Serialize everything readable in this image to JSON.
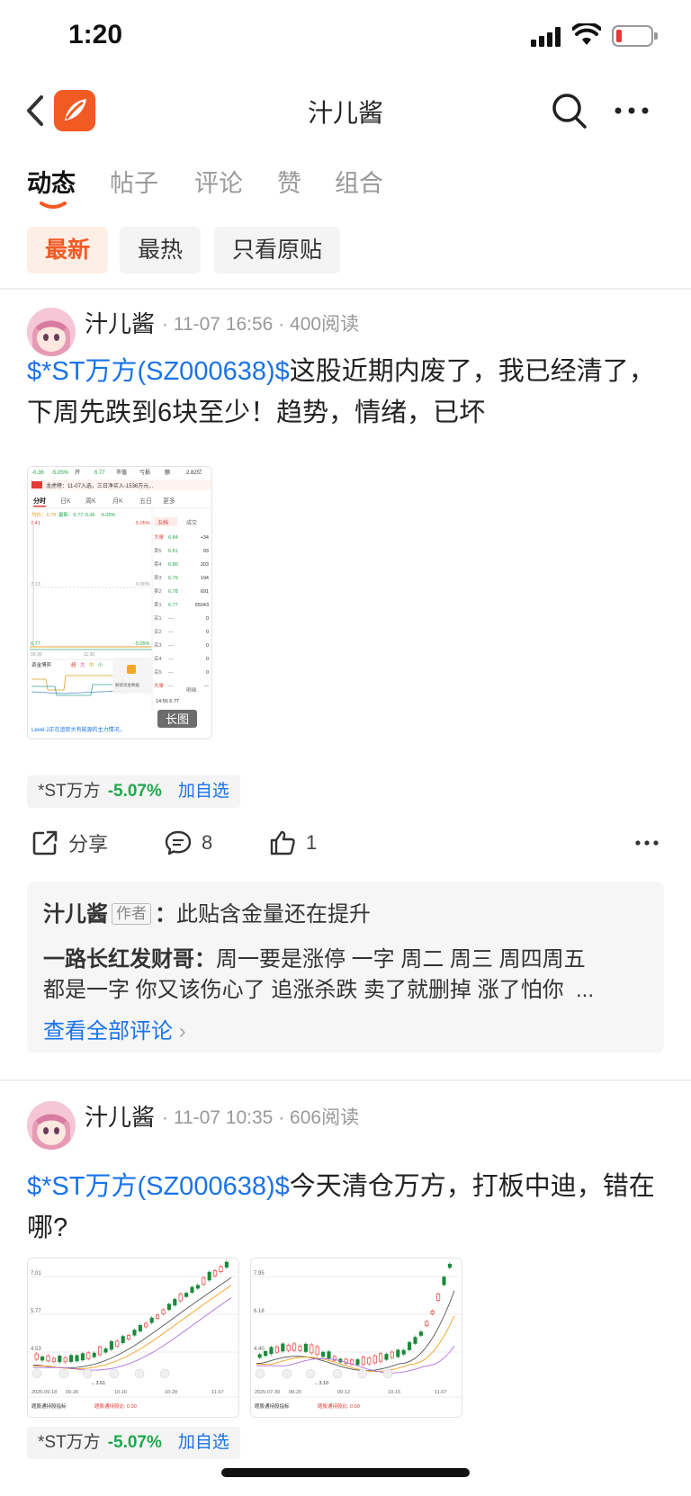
{
  "status_bar": {
    "time": "1:20"
  },
  "header": {
    "title": "汁儿酱"
  },
  "tabs": [
    "动态",
    "帖子",
    "评论",
    "赞",
    "组合"
  ],
  "filters": [
    "最新",
    "最热",
    "只看原贴"
  ],
  "colors": {
    "accent": "#f25a24",
    "link": "#1a73e8",
    "down": "#1ea84c"
  },
  "posts": [
    {
      "author": "汁儿酱",
      "time": "11-07 16:56",
      "reads": "400阅读",
      "stock_tag": "$*ST万方(SZ000638)$",
      "text": "这股近期内废了，我已经清了，下周先跌到6块至少！趋势，情绪，已坏",
      "thumb_label": "长图",
      "stock": {
        "name": "*ST万方",
        "change": "-5.07%",
        "add": "加自选"
      },
      "share_label": "分享",
      "comment_count": "8",
      "like_count": "1",
      "comments": [
        {
          "user": "汁儿酱",
          "badge": "作者",
          "text": "此贴含金量还在提升"
        },
        {
          "user": "一路长红发财哥",
          "text": "周一要是涨停 一字 周二 周三 周四周五",
          "text2": "都是一字 你又该伤心了 追涨杀跌 卖了就删掉 涨了怕你"
        }
      ],
      "view_all": "查看全部评论"
    },
    {
      "author": "汁儿酱",
      "time": "11-07 10:35",
      "reads": "606阅读",
      "stock_tag": "$*ST万方(SZ000638)$",
      "text": "今天清仓万方，打板中迪，错在哪?",
      "stock": {
        "name": "*ST万方",
        "change": "-5.07%",
        "add": "加自选"
      }
    }
  ],
  "screenshot_a": {
    "top_row": [
      "-0.36",
      "-5.05%",
      "开",
      "6.77",
      "市值",
      "亏损",
      "额",
      "2.82亿"
    ],
    "banner": "龙虎榜：11-07入选，三日净买入-1536万元...",
    "tabs": [
      "分时",
      "日K",
      "周K",
      "月K",
      "五日",
      "更多"
    ],
    "info": [
      "均价：6.79",
      "最新：6.77",
      "-0.36",
      "-5.05%"
    ],
    "price_top": "7.41",
    "pct_top": "5.05%",
    "price_mid": "7.13",
    "pct_mid": "0.00%",
    "price_bot": "6.77",
    "pct_bot": "-5.05%",
    "times": [
      "09:30",
      "11:30"
    ],
    "order_header": [
      "五档",
      "成交"
    ],
    "orders": [
      [
        "大单",
        "6.84",
        "+34"
      ],
      [
        "卖5",
        "6.81",
        "93"
      ],
      [
        "卖4",
        "6.80",
        "203"
      ],
      [
        "卖3",
        "6.79",
        "194"
      ],
      [
        "卖2",
        "6.78",
        "691"
      ],
      [
        "卖1",
        "6.77",
        "65043"
      ],
      [
        "买1",
        "---",
        "0"
      ],
      [
        "买2",
        "---",
        "0"
      ],
      [
        "买3",
        "---",
        "0"
      ],
      [
        "买4",
        "---",
        "0"
      ],
      [
        "买5",
        "---",
        "0"
      ],
      [
        "大单",
        "---",
        "---"
      ]
    ],
    "lower_legend": [
      "资金博弈",
      "超",
      "大",
      "中",
      "小"
    ],
    "lower_tab": "明细",
    "lower_trade": "14:56  6.77",
    "promo": "解锁资金数据",
    "footer": "Level-2正在追踪大有能源的主力情况，"
  },
  "screenshot_b": {
    "y_ticks": [
      "7.01",
      "5.77",
      "4.53"
    ],
    "x_ticks": [
      "2025-09-18",
      "09-26",
      "10-16",
      "10-28",
      "11-07"
    ],
    "low_label": "←3.61",
    "footer": "题股通持股指标",
    "footer_val": "题股通持股比: 0.00"
  },
  "screenshot_c": {
    "y_ticks": [
      "7.95",
      "6.18",
      "4.40"
    ],
    "x_ticks": [
      "2025-07-30",
      "08-20",
      "09-12",
      "10-15",
      "11-07"
    ],
    "low_label": "←3.10",
    "footer": "题股通持股指标",
    "footer_val": "题股通持股比: 0.00"
  }
}
